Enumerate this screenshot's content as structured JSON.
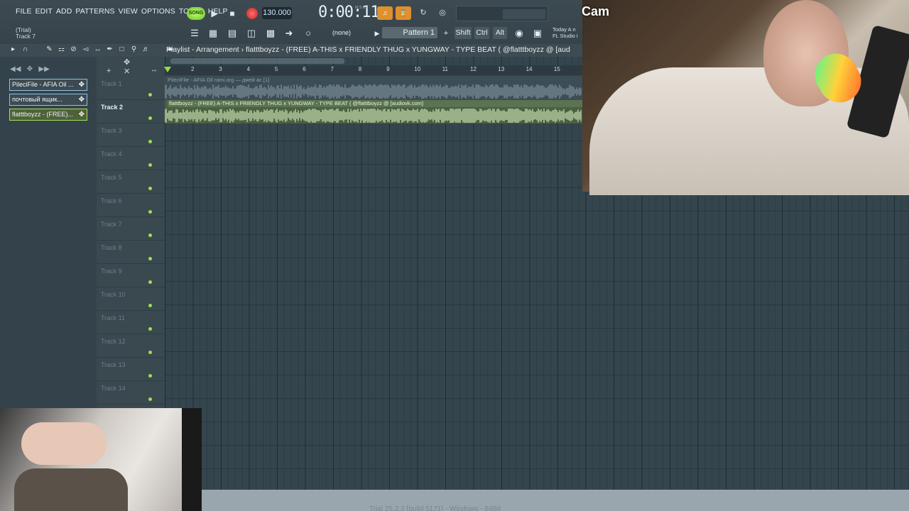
{
  "menu": [
    "FILE",
    "EDIT",
    "ADD",
    "PATTERNS",
    "VIEW",
    "OPTIONS",
    "TOOLS",
    "HELP"
  ],
  "transport": {
    "song_mode": "SONG",
    "tempo": "130.000",
    "time": "0:00:11",
    "time_unit": "M:S:CS"
  },
  "hint": {
    "line1": "(Trial)",
    "line2": "Track 7"
  },
  "snap_select": "(none)",
  "pattern_select": "Pattern 1",
  "modifier_keys": [
    "Shift",
    "Ctrl",
    "Alt"
  ],
  "news": {
    "line1": "Today  A n",
    "line2": "FL Studio i"
  },
  "playlist": {
    "title": "Playlist - Arrangement › flatttboyzz - (FREE) A-THIS x FRIENDLY THUG x YUNGWAY - TYPE BEAT ( @flatttboyzz @ [aud"
  },
  "picker": [
    {
      "label": "PileciFile - AFIA Oil ...",
      "active": false
    },
    {
      "label": "почтовый ящик...",
      "active": false
    },
    {
      "label": "flatttboyzz - (FREE)...",
      "active": true
    }
  ],
  "tracks": [
    "Track 1",
    "Track 2",
    "Track 3",
    "Track 4",
    "Track 5",
    "Track 6",
    "Track 7",
    "Track 8",
    "Track 9",
    "Track 10",
    "Track 11",
    "Track 12",
    "Track 13",
    "Track 14"
  ],
  "ruler": [
    "2",
    "3",
    "4",
    "5",
    "6",
    "7",
    "8",
    "9",
    "10",
    "11",
    "12",
    "13",
    "14",
    "15"
  ],
  "clips": {
    "clip1": "PileciFile - AFIA Oil  rami.org — джей ас [1]",
    "clip2": "flatttboyzz - (FREE) A-THIS x FRIENDLY THUG x YUNGWAY - TYPE BEAT ( @flatttboyzz @ [audiovk.com]"
  },
  "footer": "Trial 25.2.2 [build 5171] - Windows - 64Bit",
  "cam": {
    "label": "Cam"
  },
  "colors": {
    "accent_green": "#9be050",
    "orange": "#e0902c",
    "record_red": "#c82020"
  }
}
